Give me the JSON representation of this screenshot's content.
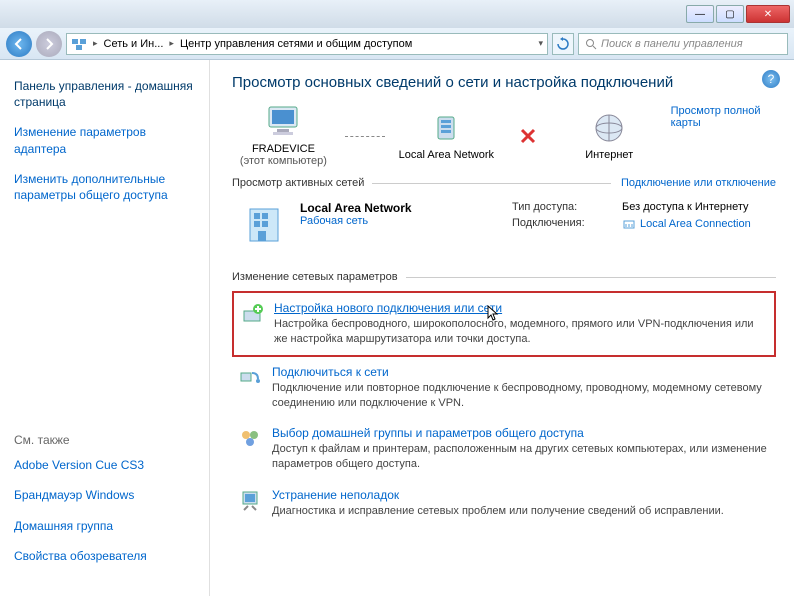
{
  "titlebar": {
    "min": "—",
    "max": "▢",
    "close": "✕"
  },
  "nav": {
    "crumb1": "Сеть и Ин...",
    "crumb2": "Центр управления сетями и общим доступом",
    "search_placeholder": "Поиск в панели управления"
  },
  "sidebar": {
    "home": "Панель управления - домашняя страница",
    "link1": "Изменение параметров адаптера",
    "link2": "Изменить дополнительные параметры общего доступа",
    "seealso": "См. также",
    "rel1": "Adobe Version Cue CS3",
    "rel2": "Брандмауэр Windows",
    "rel3": "Домашняя группа",
    "rel4": "Свойства обозревателя"
  },
  "main": {
    "title": "Просмотр основных сведений о сети и настройка подключений",
    "fullmap": "Просмотр полной карты",
    "node_pc": "FRADEVICE",
    "node_pc_sub": "(этот компьютер)",
    "node_lan": "Local Area Network",
    "node_inet": "Интернет",
    "active_hdr": "Просмотр активных сетей",
    "active_link": "Подключение или отключение",
    "net_name": "Local Area Network",
    "net_type": "Рабочая сеть",
    "access_lbl": "Тип доступа:",
    "access_val": "Без доступа к Интернету",
    "conn_lbl": "Подключения:",
    "conn_val": "Local Area Connection",
    "change_hdr": "Изменение сетевых параметров",
    "tasks": [
      {
        "title": "Настройка нового подключения или сети",
        "desc": "Настройка беспроводного, широкополосного, модемного, прямого или VPN-подключения или же настройка маршрутизатора или точки доступа."
      },
      {
        "title": "Подключиться к сети",
        "desc": "Подключение или повторное подключение к беспроводному, проводному, модемному сетевому соединению или подключение к VPN."
      },
      {
        "title": "Выбор домашней группы и параметров общего доступа",
        "desc": "Доступ к файлам и принтерам, расположенным на других сетевых компьютерах, или изменение параметров общего доступа."
      },
      {
        "title": "Устранение неполадок",
        "desc": "Диагностика и исправление сетевых проблем или получение сведений об исправлении."
      }
    ]
  }
}
